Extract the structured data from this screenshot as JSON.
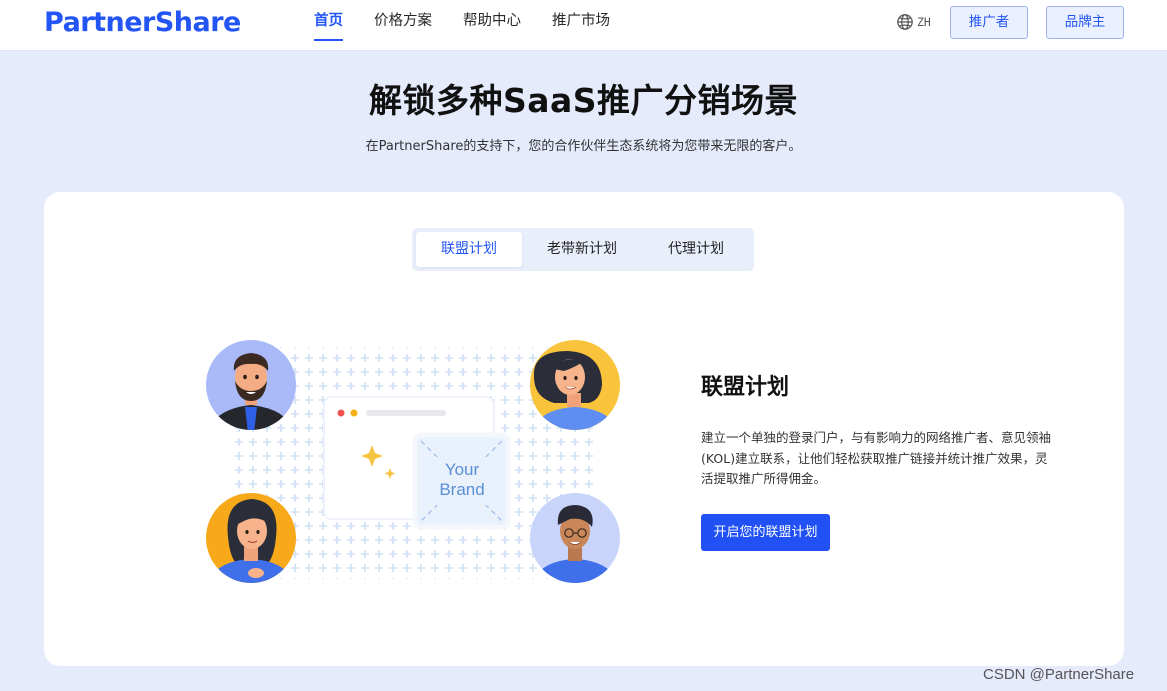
{
  "header": {
    "logo": "PartnerShare",
    "nav": [
      {
        "label": "首页",
        "active": true
      },
      {
        "label": "价格方案",
        "active": false
      },
      {
        "label": "帮助中心",
        "active": false
      },
      {
        "label": "推广市场",
        "active": false
      }
    ],
    "language": {
      "icon": "globe-icon",
      "code": "ZH"
    },
    "promoter_button": "推广者",
    "brand_button": "品牌主"
  },
  "hero": {
    "title": "解锁多种SaaS推广分销场景",
    "subtitle": "在PartnerShare的支持下，您的合作伙伴生态系统将为您带来无限的客户。"
  },
  "tabs": [
    {
      "label": "联盟计划",
      "active": true
    },
    {
      "label": "老带新计划",
      "active": false
    },
    {
      "label": "代理计划",
      "active": false
    }
  ],
  "illustration": {
    "brand_line1": "Your",
    "brand_line2": "Brand"
  },
  "panel": {
    "title": "联盟计划",
    "description": "建立一个单独的登录门户，与有影响力的网络推广者、意见领袖(KOL)建立联系，让他们轻松获取推广链接并统计推广效果，灵活提取推广所得佣金。",
    "cta": "开启您的联盟计划"
  },
  "watermark": "CSDN @PartnerShare",
  "colors": {
    "accent": "#2355f5",
    "page_background": "#e6ebfc",
    "cta_background": "#2151f5"
  }
}
